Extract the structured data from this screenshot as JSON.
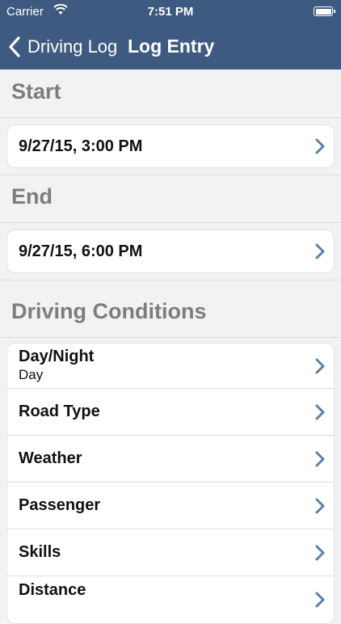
{
  "status_bar": {
    "carrier": "Carrier",
    "time": "7:51 PM"
  },
  "nav": {
    "back_label": "Driving Log",
    "title": "Log Entry"
  },
  "sections": {
    "start": {
      "header": "Start",
      "value": "9/27/15, 3:00 PM"
    },
    "end": {
      "header": "End",
      "value": "9/27/15, 6:00 PM"
    },
    "conditions": {
      "header": "Driving Conditions",
      "items": [
        {
          "label": "Day/Night",
          "value": "Day"
        },
        {
          "label": "Road Type"
        },
        {
          "label": "Weather"
        },
        {
          "label": "Passenger"
        },
        {
          "label": "Skills"
        },
        {
          "label": "Distance"
        }
      ]
    }
  },
  "colors": {
    "nav_bg": "#3e5a80",
    "chevron": "#5b7fa5",
    "header_text": "#7d7d7d"
  },
  "icons": {
    "back": "chevron-left-icon",
    "row": "chevron-right-icon",
    "wifi": "wifi-icon",
    "battery": "battery-icon"
  }
}
